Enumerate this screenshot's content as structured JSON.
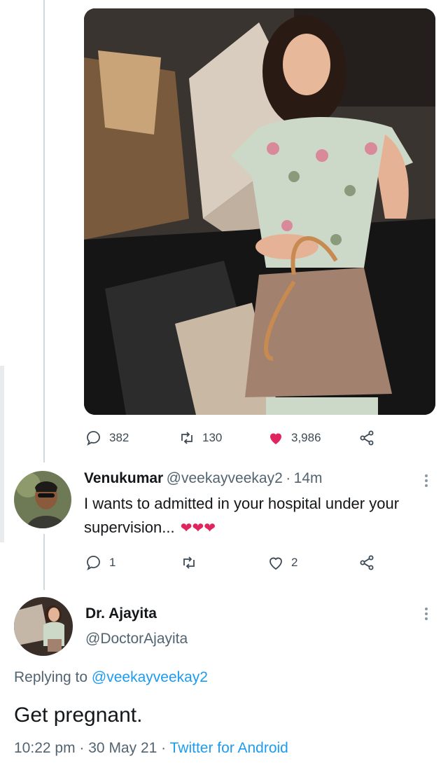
{
  "tweet": {
    "stats": {
      "replies": "382",
      "retweets": "130",
      "likes": "3,986"
    },
    "colors": {
      "like": "#e0245e",
      "muted": "#536471",
      "link": "#1d9bf0"
    }
  },
  "reply1": {
    "name": "Venukumar",
    "handle": "@veekayveekay2",
    "separator": "·",
    "time": "14m",
    "text": "I wants to admitted in your hospital under your supervision...",
    "emoji": "❤❤❤",
    "stats": {
      "replies": "1",
      "likes": "2"
    }
  },
  "reply2": {
    "name": "Dr. Ajayita",
    "handle": "@DoctorAjayita",
    "replying_label": "Replying to",
    "replying_handle": "@veekayveekay2",
    "text": "Get pregnant.",
    "time": "10:22 pm",
    "sep1": "·",
    "date": "30 May 21",
    "sep2": "·",
    "source": "Twitter for Android"
  },
  "icons": [
    "reply-icon",
    "retweet-icon",
    "heart-icon",
    "share-icon",
    "more-icon"
  ]
}
